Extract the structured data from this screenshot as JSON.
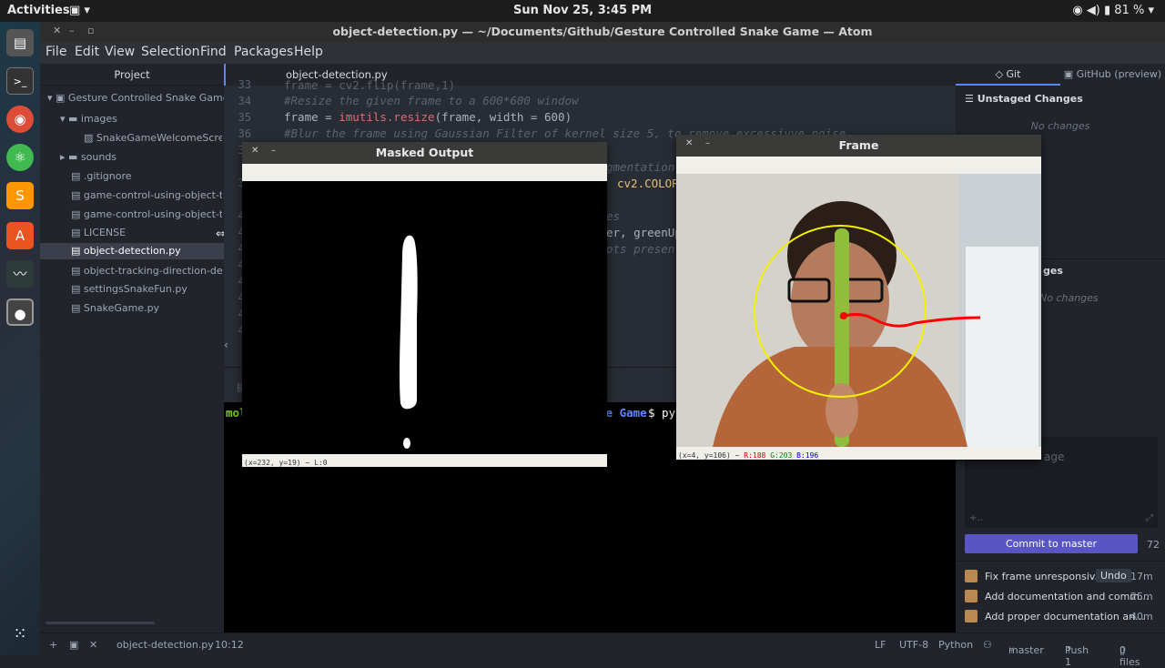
{
  "topbar": {
    "activities": "Activities",
    "clock": "Sun Nov 25,  3:45 PM",
    "battery": "81 %"
  },
  "window": {
    "title": "object-detection.py — ~/Documents/Github/Gesture Controlled Snake Game — Atom"
  },
  "menu": [
    "File",
    "Edit",
    "View",
    "Selection",
    "Find",
    "Packages",
    "Help"
  ],
  "tree": {
    "header": "Project",
    "root": "Gesture Controlled Snake Game",
    "items": [
      "images",
      "SnakeGameWelcomeScreen.",
      "sounds",
      ".gitignore",
      "game-control-using-object-track",
      "game-control-using-object-track",
      "LICENSE",
      "object-detection.py",
      "object-tracking-direction-detect",
      "settingsSnakeFun.py",
      "SnakeGame.py"
    ]
  },
  "editor": {
    "tab": "object-detection.py",
    "line_numbers": [
      "33",
      "34",
      "35",
      "36",
      "37",
      "38",
      "39",
      "40",
      "41",
      "42",
      "43",
      "44",
      "45",
      "46",
      "47",
      "48"
    ],
    "code": {
      "l33": "frame = cv2.flip(frame,1)",
      "l34": "#Resize the given frame to a 600*600 window",
      "l35a": "frame = ",
      "l35b": "imutils.resize",
      "l35c": "(frame, width = 600)",
      "l36": "#Blur the frame using Gaussian Filter of kernel size 5, to remove excessivve noise",
      "l38": "gmentation",
      "l39": "cv2.COLOR",
      "l41": "es",
      "l42": "er, greenUp",
      "l43": "ots present"
    }
  },
  "terminal": {
    "prompt_left": "mol",
    "prompt_right": "ke Game",
    "cmd": "$ py"
  },
  "masked_window": {
    "title": "Masked Output",
    "status": "(x=232, y=19) ~ L:0"
  },
  "frame_window": {
    "title": "Frame",
    "status_xy": "(x=4, y=106) ~",
    "r": "R:188",
    "g": "G:203",
    "b": "B:196"
  },
  "git": {
    "tab_git": "Git",
    "tab_github": "GitHub (preview)",
    "unstaged": "Unstaged Changes",
    "no_changes_1": "No changes",
    "staged_tail": "ges",
    "no_changes_2": "No changes",
    "commit_placeholder": "age",
    "commit_button": "Commit to master",
    "char_count": "72",
    "commits": [
      {
        "msg": "Fix frame unresponsiv...",
        "undo": "Undo",
        "time": "17m"
      },
      {
        "msg": "Add documentation and comm...",
        "time": "25m"
      },
      {
        "msg": "Add proper documentation an...",
        "time": "40m"
      }
    ]
  },
  "statusbar": {
    "file": "object-detection.py",
    "pos": "10:12",
    "eol": "LF",
    "enc": "UTF-8",
    "grammar": "Python",
    "branch": "master",
    "push": "Push 1",
    "files": "0 files"
  },
  "colors": {
    "accent": "#5a55c4",
    "terminal_green": "#7ad02a",
    "terminal_blue": "#5f87ff"
  }
}
